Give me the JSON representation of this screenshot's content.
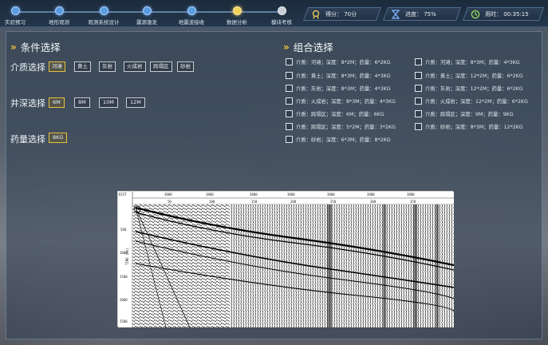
{
  "steps": [
    {
      "label": "实验预习",
      "state": "done"
    },
    {
      "label": "地形观测",
      "state": "done"
    },
    {
      "label": "观测系统设计",
      "state": "done"
    },
    {
      "label": "震源激发",
      "state": "done"
    },
    {
      "label": "地震波接收",
      "state": "done"
    },
    {
      "label": "数据分析",
      "state": "active"
    },
    {
      "label": "模块考核",
      "state": "pending"
    }
  ],
  "stats": {
    "score": "得分：  70分",
    "progress": "进度：   75%",
    "time": "用时：   00:35:15"
  },
  "left_title": "条件选择",
  "right_title": "组合选择",
  "medium": {
    "label": "介质选择",
    "options": [
      "河滩",
      "黄土",
      "灰岩",
      "火成岩",
      "跨塌区",
      "砂岩"
    ],
    "selected": "河滩"
  },
  "depth": {
    "label": "井深选择",
    "options": [
      "6M",
      "8M",
      "10M",
      "12M"
    ],
    "selected": "6M"
  },
  "charge": {
    "label": "药量选择",
    "options": [
      "8KG"
    ],
    "selected": "8KG"
  },
  "combos_left": [
    "介质：河滩；深度：8*2M；药量：6*2KG",
    "介质：黄土；深度：8*3M；药量：4*3KG",
    "介质：灰岩；深度：8*3M；药量：4*3KG",
    "介质：火成岩；深度：8*3M；药量：4*3KG",
    "介质：跨塌区；深度：6M；药量：6KG",
    "介质：跨塌区；深度：5*2M；药量：3*2KG",
    "介质：砂岩；深度：6*3M；药量：8*2KG"
  ],
  "combos_right": [
    "介质：河滩；深度：8*3M；药量：4*3KG",
    "介质：黄土；深度：12*2M；药量：6*2KG",
    "介质：灰岩；深度：12*2M；药量：6*2KG",
    "介质：火成岩；深度：12*2M；药量：6*2KG",
    "介质：跨塌区；深度：9M；药量：9KG",
    "介质：砂岩；深度：8*3M；药量：12*2KG"
  ],
  "seismic": {
    "y_ticks": [
      "500",
      "1000",
      "1500",
      "2000",
      "2500"
    ],
    "x_ticks_top": [
      "3800",
      "3800",
      "3800",
      "3800",
      "3800",
      "3800",
      "3800"
    ],
    "x_ticks_bottom": [
      "50",
      "100",
      "150",
      "200",
      "250",
      "300",
      "350"
    ],
    "y_axis_label": "TIME (ms)",
    "corner_label": "DIST"
  }
}
